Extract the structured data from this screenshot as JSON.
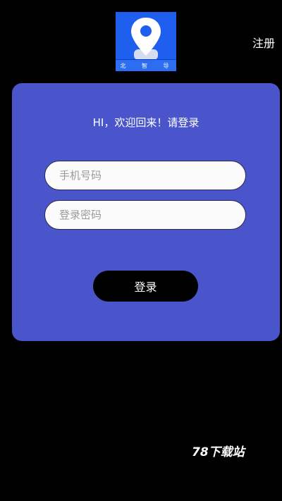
{
  "header": {
    "logo_text": "北 智 导",
    "register_label": "注册"
  },
  "card": {
    "welcome_text": "HI，欢迎回来！请登录",
    "phone_placeholder": "手机号码",
    "password_placeholder": "登录密码",
    "login_label": "登录"
  },
  "watermark": "78下载站",
  "colors": {
    "background": "#000000",
    "card": "#4a55cc",
    "logo": "#1f5ff0",
    "button": "#000000"
  }
}
